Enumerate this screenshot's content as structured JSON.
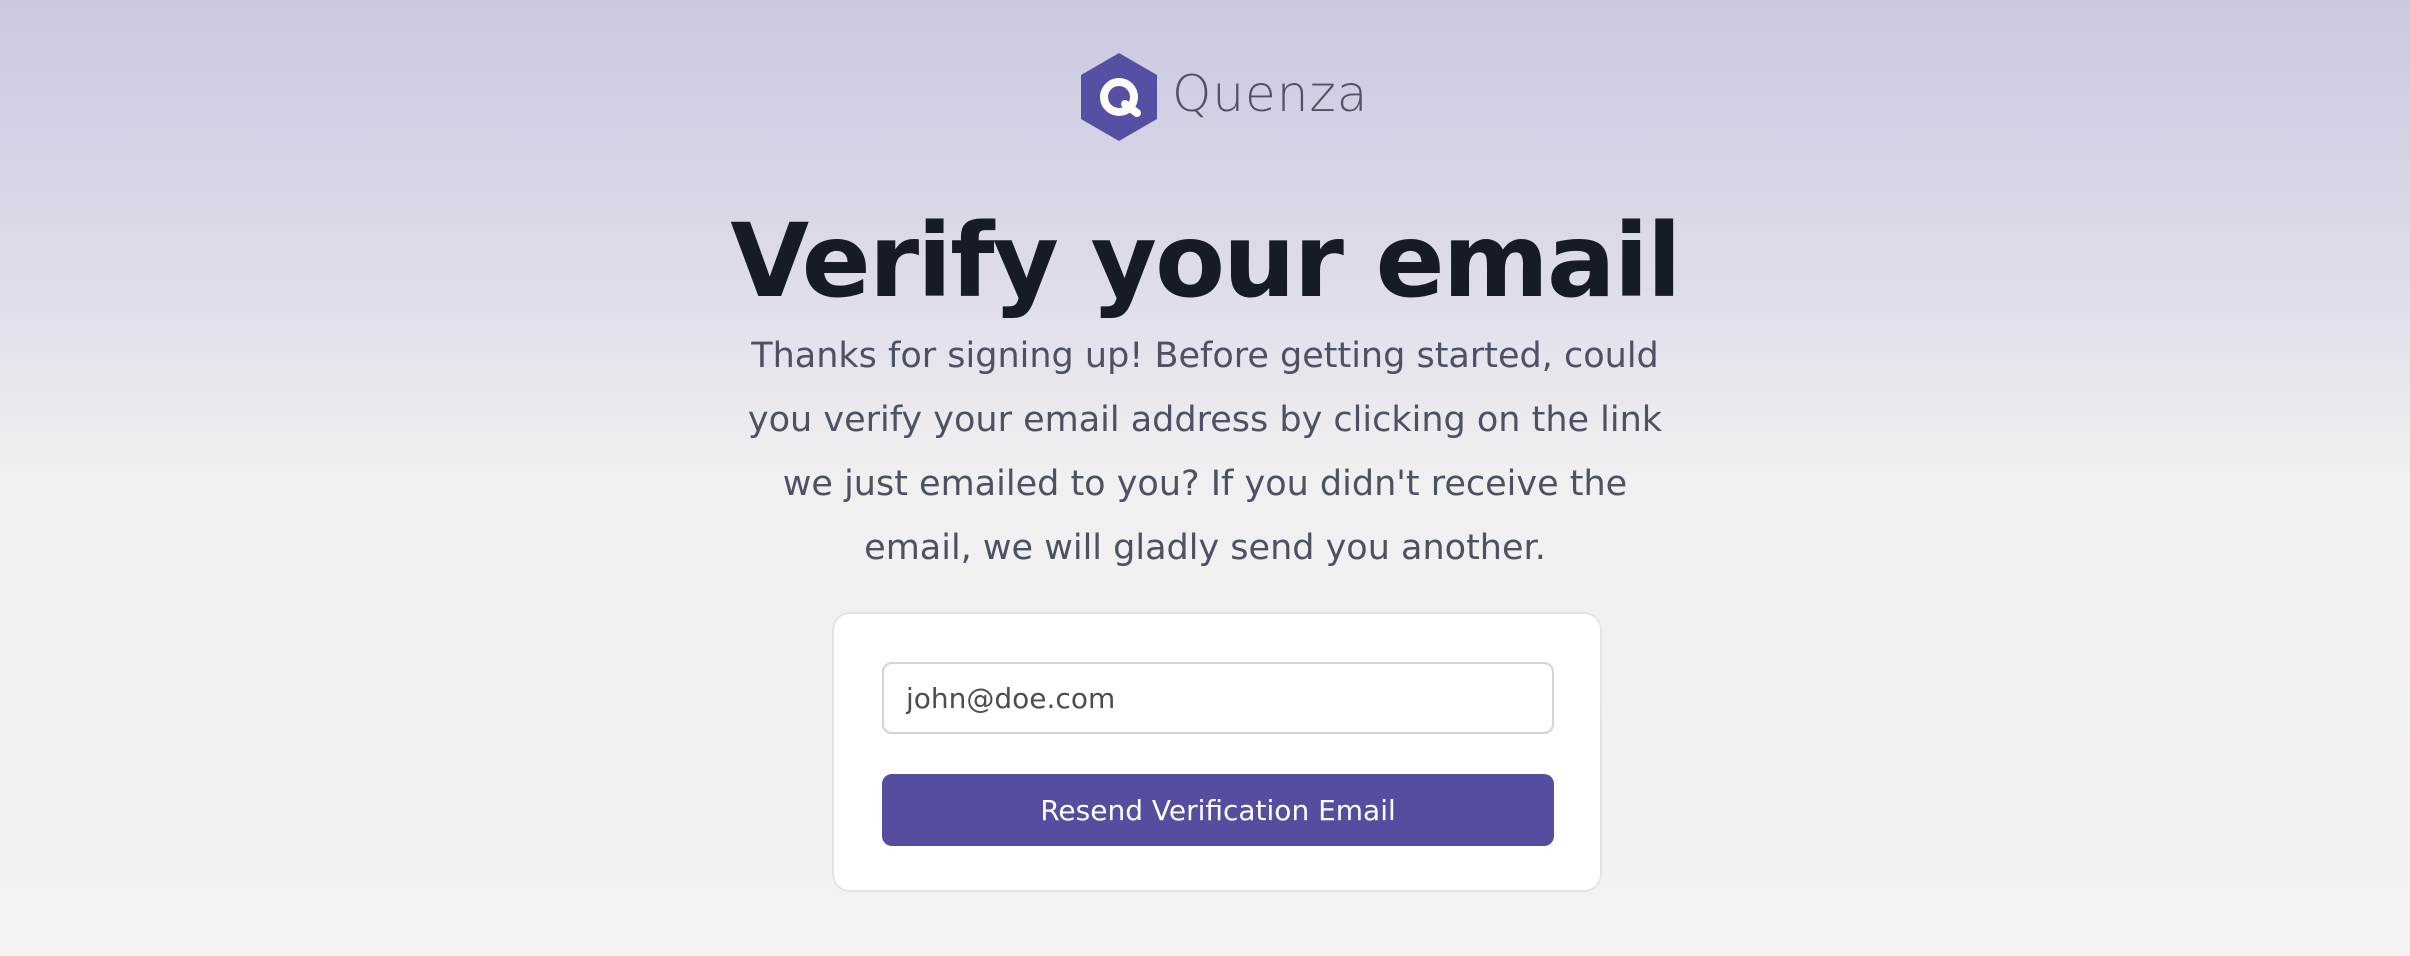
{
  "brand": {
    "name": "Quenza",
    "logo_icon": "hexagon-q-icon",
    "color": "#5650a4"
  },
  "heading": {
    "title": "Verify your email",
    "subtitle": "Thanks for signing up! Before getting started, could you verify your email address by clicking on the link we just emailed to you? If you didn't receive the email, we will gladly send you another."
  },
  "form": {
    "email_value": "john@doe.com",
    "resend_label": "Resend Verification Email",
    "button_color": "#544da0"
  }
}
